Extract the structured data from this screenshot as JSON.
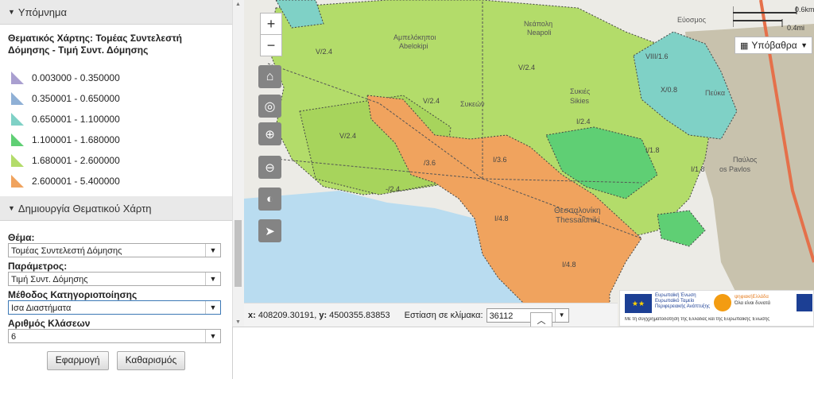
{
  "legend_panel": {
    "header": "Υπόμνημα",
    "title": "Θεματικός Χάρτης: Τομέας Συντελεστή Δόμησης - Τιμή Συντ. Δόμησης",
    "classes": [
      {
        "label": "0.003000 - 0.350000",
        "color": "#a99fd0"
      },
      {
        "label": "0.350001 - 0.650000",
        "color": "#8fb0d6"
      },
      {
        "label": "0.650001 - 1.100000",
        "color": "#7fd1c6"
      },
      {
        "label": "1.100001 - 1.680000",
        "color": "#5fcf74"
      },
      {
        "label": "1.680001 - 2.600000",
        "color": "#b3dc6a"
      },
      {
        "label": "2.600001 - 5.400000",
        "color": "#f0a35e"
      }
    ]
  },
  "thematic_panel": {
    "header": "Δημιουργία Θεματικού Χάρτη",
    "theme_label": "Θέμα:",
    "theme_value": "Τομέας Συντελεστή Δόμησης",
    "param_label": "Παράμετρος:",
    "param_value": "Τιμή Συντ. Δόμησης",
    "method_label": "Μέθοδος Κατηγοριοποίησης",
    "method_value": "Ισα Διαστήματα",
    "classes_label": "Αριθμός Κλάσεων",
    "classes_value": "6",
    "apply_button": "Εφαρμογή",
    "clear_button": "Καθαρισμός"
  },
  "map": {
    "zoom_in": "+",
    "zoom_out": "−",
    "basemap_button": "Υπόβαθρα",
    "scale_km": "0.6km",
    "scale_mi": "0.4mi",
    "coord_x_label": "x:",
    "coord_x": "408209.30191,",
    "coord_y_label": "y:",
    "coord_y": "4500355.83853",
    "focus_label": "Εστίαση σε κλίμακα:",
    "scale_value": "36112",
    "place_labels": [
      {
        "text": "Αμπελόκηποι",
        "id": "ampelokipoi"
      },
      {
        "text": "Abelokipi",
        "id": "abelokipi"
      },
      {
        "text": "Νεάπολη",
        "id": "neapoli"
      },
      {
        "text": "Neapoli",
        "id": "neapoli-en"
      },
      {
        "text": "Συκιές",
        "id": "sykies"
      },
      {
        "text": "Sikies",
        "id": "sikies"
      },
      {
        "text": "Θεσσαλονίκη",
        "id": "thessaloniki"
      },
      {
        "text": "Thessaloniki",
        "id": "thessaloniki-en"
      },
      {
        "text": "Πεύκα",
        "id": "pefka"
      },
      {
        "text": "Παύλος",
        "id": "pavlos"
      },
      {
        "text": "os Pavlos",
        "id": "os-pavlos"
      },
      {
        "text": "Εύοσμος",
        "id": "evosmos"
      },
      {
        "text": "Συκεών",
        "id": "sykeon"
      }
    ],
    "zone_codes": [
      "V/2.4",
      "V/2.4",
      "V/2.4",
      "-/2.4",
      "V/2.4",
      "VIII/1.6",
      "X/0.8",
      "I/3.6",
      "/3.6",
      "I/4.8",
      "I/4.8",
      "I/1.8",
      "I/1.8",
      "I/2.4"
    ]
  },
  "eu_banner": {
    "eu_text": "Ευρωπαϊκή Ένωση",
    "fund_text": "Ευρωπαϊκό Ταμείο Περιφερειακής Ανάπτυξης",
    "digital_text": "ψηφιακήΕλλάδα",
    "digital_sub": "Όλα είναι δυνατά",
    "cofund": "Με τη συγχρηματοδότηση της Ελλάδας και της Ευρωπαϊκής Ένωσης"
  }
}
